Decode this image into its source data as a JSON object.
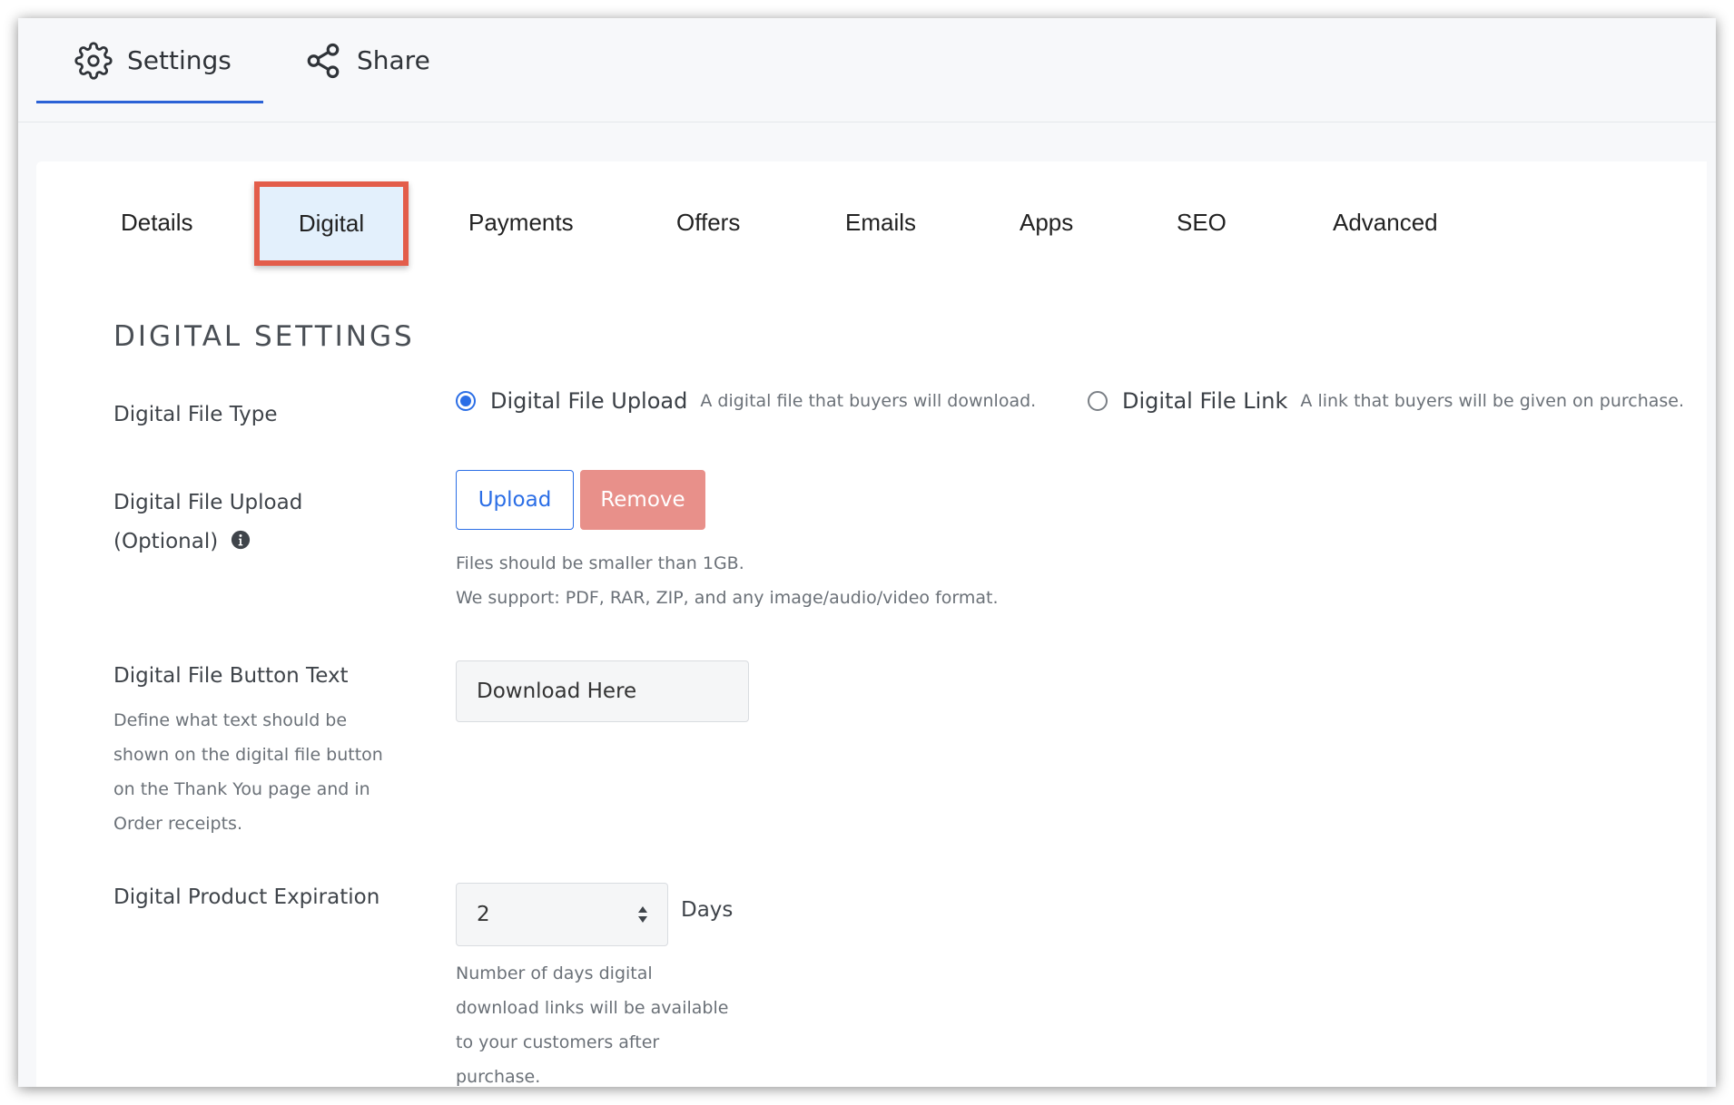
{
  "header": {
    "tabs": [
      {
        "label": "Settings",
        "icon": "gear-icon",
        "active": true
      },
      {
        "label": "Share",
        "icon": "share-icon",
        "active": false
      }
    ],
    "accent": "#2b62d6"
  },
  "subtabs": [
    {
      "label": "Details"
    },
    {
      "label": "Digital",
      "active": true
    },
    {
      "label": "Payments"
    },
    {
      "label": "Offers"
    },
    {
      "label": "Emails"
    },
    {
      "label": "Apps"
    },
    {
      "label": "SEO"
    },
    {
      "label": "Advanced"
    }
  ],
  "highlight_color": "#e35d4a",
  "section": {
    "title": "DIGITAL SETTINGS"
  },
  "file_type": {
    "label": "Digital File Type",
    "options": [
      {
        "label": "Digital File Upload",
        "description": "A digital file that buyers will download.",
        "checked": true
      },
      {
        "label": "Digital File Link",
        "description": "A link that buyers will be given on purchase.",
        "checked": false
      }
    ]
  },
  "file_upload": {
    "label_line1": "Digital File Upload",
    "label_line2": "(Optional)",
    "info_icon": "info-icon",
    "upload_label": "Upload",
    "remove_label": "Remove",
    "note_line1": "Files should be smaller than 1GB.",
    "note_line2": "We support: PDF, RAR, ZIP, and any image/audio/video format."
  },
  "button_text": {
    "label": "Digital File Button Text",
    "help_lines": [
      "Define what text should be",
      "shown on the digital file button",
      "on the Thank You page and in",
      "Order receipts."
    ],
    "value": "Download Here"
  },
  "expiration": {
    "label": "Digital Product Expiration",
    "value": "2",
    "unit": "Days",
    "help_lines": [
      "Number of days digital",
      "download links will be available",
      "to your customers after",
      "purchase."
    ]
  }
}
